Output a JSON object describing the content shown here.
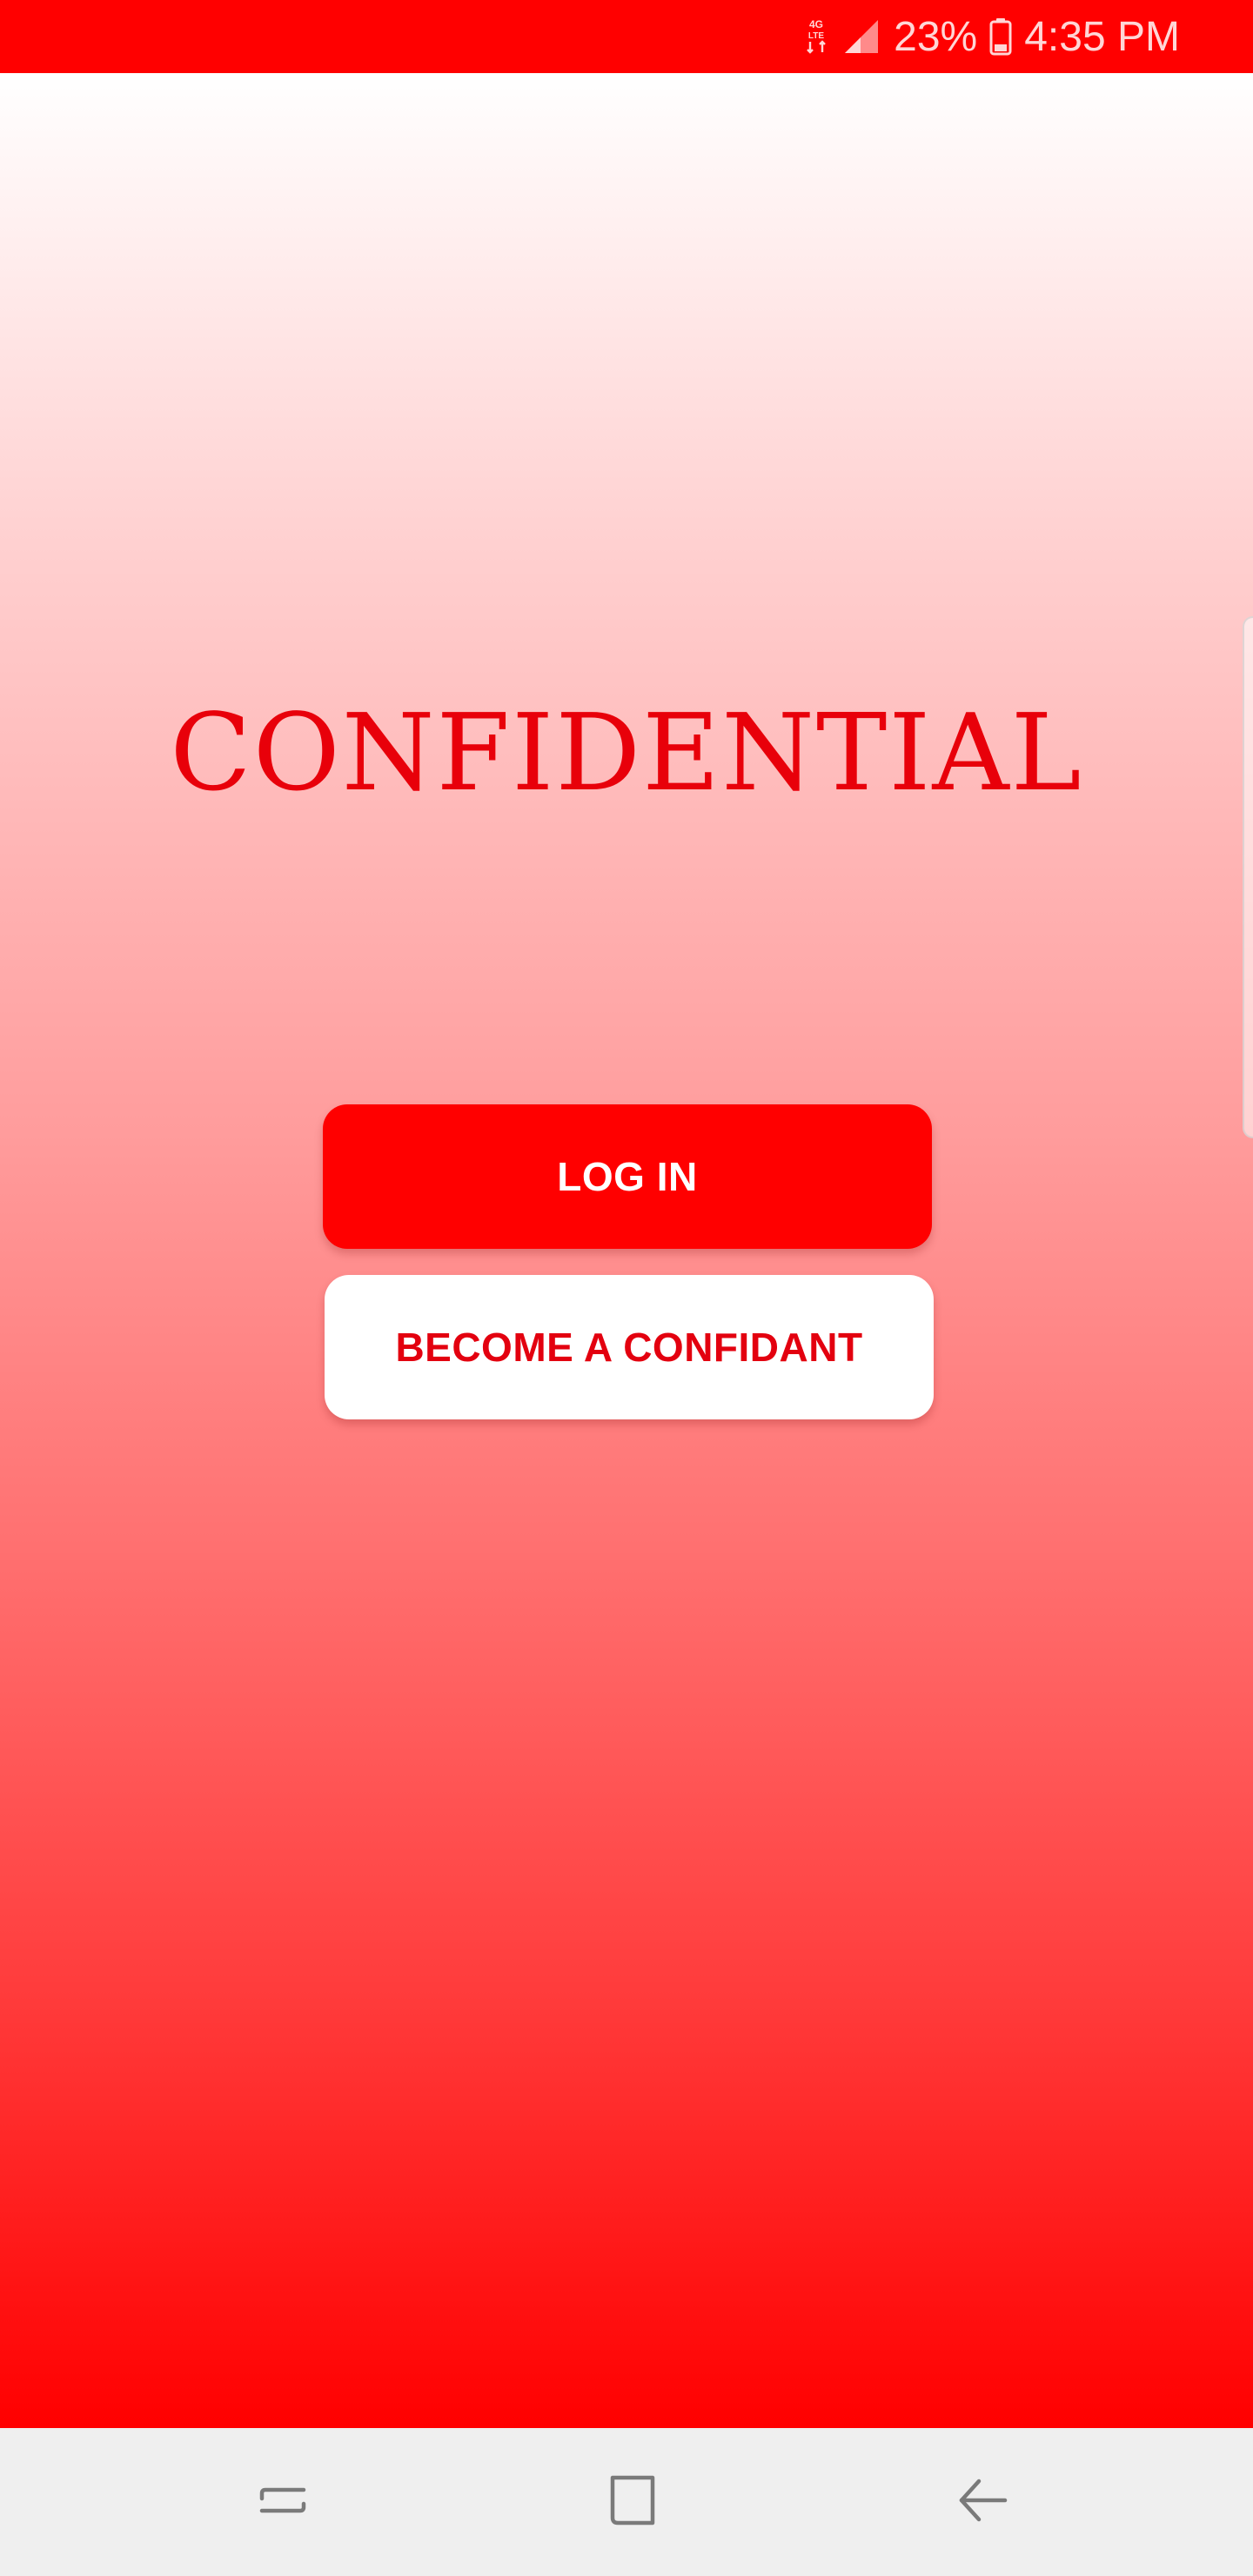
{
  "status_bar": {
    "network": "4G LTE",
    "battery": "23%",
    "time": "4:35 PM",
    "icons": [
      "network-4g-lte-icon",
      "signal-icon",
      "battery-icon"
    ]
  },
  "app": {
    "title": "CONFIDENTIAL"
  },
  "buttons": {
    "login_label": "LOG IN",
    "confidant_label": "BECOME A CONFIDANT"
  },
  "navigation": {
    "icons": [
      "recents-icon",
      "home-icon",
      "back-icon"
    ]
  },
  "colors": {
    "brand_red": "#ff0000",
    "title_red": "#e8000a",
    "button_text_white": "#ffffff",
    "nav_bar_bg": "#efefef"
  }
}
